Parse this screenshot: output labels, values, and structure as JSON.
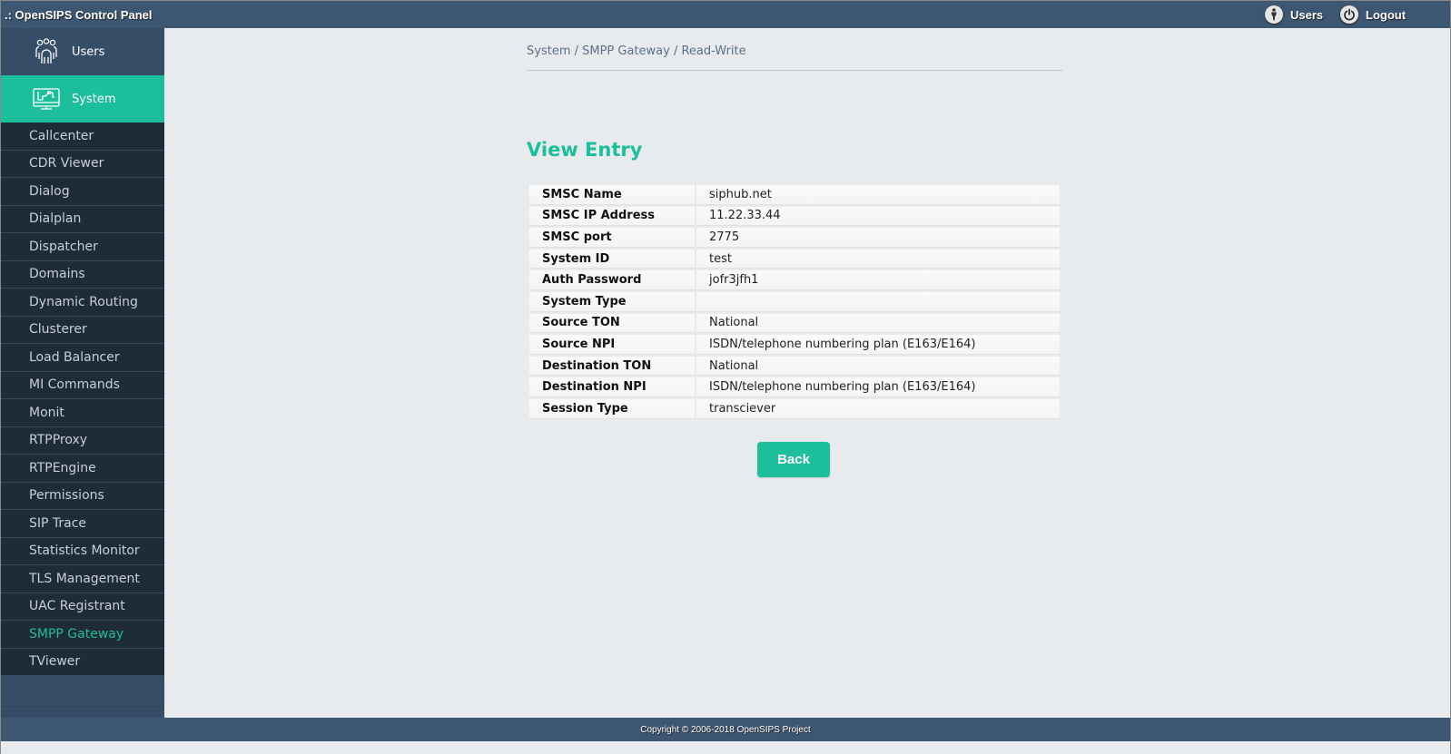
{
  "header": {
    "title": ".: OpenSIPS Control Panel",
    "users_label": "Users",
    "logout_label": "Logout"
  },
  "sidebar": {
    "sections": [
      {
        "label": "Users",
        "icon": "users-group-icon"
      },
      {
        "label": "System",
        "icon": "system-monitor-icon",
        "active": true
      }
    ],
    "items": [
      {
        "label": "Callcenter"
      },
      {
        "label": "CDR Viewer"
      },
      {
        "label": "Dialog"
      },
      {
        "label": "Dialplan"
      },
      {
        "label": "Dispatcher"
      },
      {
        "label": "Domains"
      },
      {
        "label": "Dynamic Routing"
      },
      {
        "label": "Clusterer"
      },
      {
        "label": "Load Balancer"
      },
      {
        "label": "MI Commands"
      },
      {
        "label": "Monit"
      },
      {
        "label": "RTPProxy"
      },
      {
        "label": "RTPEngine"
      },
      {
        "label": "Permissions"
      },
      {
        "label": "SIP Trace"
      },
      {
        "label": "Statistics Monitor"
      },
      {
        "label": "TLS Management"
      },
      {
        "label": "UAC Registrant"
      },
      {
        "label": "SMPP Gateway",
        "active": true
      },
      {
        "label": "TViewer"
      }
    ]
  },
  "main": {
    "breadcrumb": "System / SMPP Gateway / Read-Write",
    "heading": "View Entry",
    "rows": [
      {
        "key": "SMSC Name",
        "value": "siphub.net"
      },
      {
        "key": "SMSC IP Address",
        "value": "11.22.33.44"
      },
      {
        "key": "SMSC port",
        "value": "2775"
      },
      {
        "key": "System ID",
        "value": "test"
      },
      {
        "key": "Auth Password",
        "value": "jofr3jfh1"
      },
      {
        "key": "System Type",
        "value": ""
      },
      {
        "key": "Source TON",
        "value": "National"
      },
      {
        "key": "Source NPI",
        "value": "ISDN/telephone numbering plan (E163/E164)"
      },
      {
        "key": "Destination TON",
        "value": "National"
      },
      {
        "key": "Destination NPI",
        "value": "ISDN/telephone numbering plan (E163/E164)"
      },
      {
        "key": "Session Type",
        "value": "transciever"
      }
    ],
    "back_label": "Back"
  },
  "footer": {
    "copyright": "Copyright © 2006-2018 OpenSIPS Project"
  },
  "colors": {
    "accent": "#1cbe9b",
    "topbar": "#3d5671",
    "sidebar_dark": "#202b38"
  }
}
